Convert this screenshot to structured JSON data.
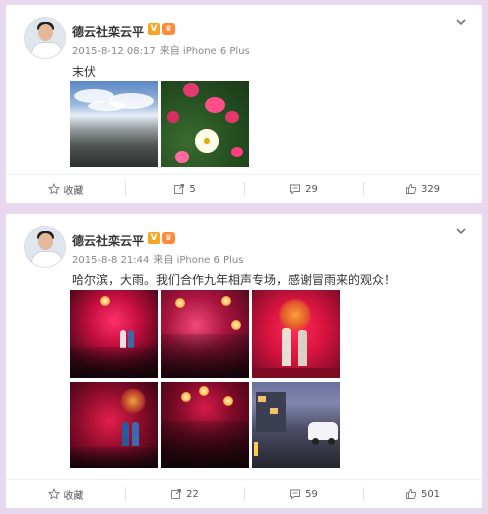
{
  "posts": [
    {
      "author": "德云社栾云平",
      "timestamp": "2015-8-12 08:17",
      "source": "来自 iPhone 6 Plus",
      "text": "末伏",
      "actions": {
        "favorite": "收藏",
        "repost": "5",
        "comment": "29",
        "like": "329"
      }
    },
    {
      "author": "德云社栾云平",
      "timestamp": "2015-8-8 21:44",
      "source": "来自 iPhone 6 Plus",
      "text": "哈尔滨，大雨。我们合作九年相声专场，感谢冒雨来的观众！",
      "actions": {
        "favorite": "收藏",
        "repost": "22",
        "comment": "59",
        "like": "501"
      }
    }
  ],
  "colors": {
    "accent": "#f5a623",
    "background": "#e9d7ef"
  }
}
